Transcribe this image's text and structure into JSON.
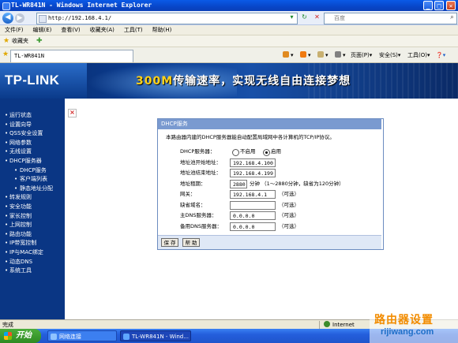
{
  "window": {
    "title": "TL-WR841N - Windows Internet Explorer",
    "min": "_",
    "max": "□",
    "close": "✕"
  },
  "address": {
    "url": "http://192.168.4.1/",
    "go": "▾",
    "refresh": "↻",
    "stop": "✕",
    "search_placeholder": "百度",
    "search_icon": "search-icon"
  },
  "menu": {
    "items": [
      "文件(F)",
      "编辑(E)",
      "查看(V)",
      "收藏夹(A)",
      "工具(T)",
      "帮助(H)"
    ]
  },
  "favorites": {
    "label": "收藏夹"
  },
  "tabs": {
    "current": "TL-WR841N",
    "toolbar": {
      "page": "页面(P)",
      "safety": "安全(S)",
      "tools": "工具(O)",
      "help": "❓"
    }
  },
  "banner": {
    "logo": "TP-LINK",
    "slogan_hi": "300M",
    "slogan": "传输速率，实现无线自由连接梦想"
  },
  "nav": {
    "items": [
      {
        "label": "运行状态",
        "sub": false
      },
      {
        "label": "设置向导",
        "sub": false
      },
      {
        "label": "QSS安全设置",
        "sub": false
      },
      {
        "label": "网络参数",
        "sub": false
      },
      {
        "label": "无线设置",
        "sub": false
      },
      {
        "label": "DHCP服务器",
        "sub": false
      },
      {
        "label": "DHCP服务",
        "sub": true
      },
      {
        "label": "客户端列表",
        "sub": true
      },
      {
        "label": "静态地址分配",
        "sub": true
      },
      {
        "label": "转发规则",
        "sub": false
      },
      {
        "label": "安全功能",
        "sub": false
      },
      {
        "label": "家长控制",
        "sub": false
      },
      {
        "label": "上网控制",
        "sub": false
      },
      {
        "label": "路由功能",
        "sub": false
      },
      {
        "label": "IP带宽控制",
        "sub": false
      },
      {
        "label": "IP与MAC绑定",
        "sub": false
      },
      {
        "label": "动态DNS",
        "sub": false
      },
      {
        "label": "系统工具",
        "sub": false
      }
    ]
  },
  "panel": {
    "title": "DHCP服务",
    "description": "本路由器内建的DHCP服务器能自动配置局域网中各计算机的TCP/IP协议。",
    "dhcp_server_label": "DHCP服务器：",
    "radio_off": "不启用",
    "radio_on": "启用",
    "dhcp_enabled": true,
    "start_label": "地址池开始地址：",
    "start_value": "192.168.4.100",
    "end_label": "地址池结束地址：",
    "end_value": "192.168.4.199",
    "lease_label": "地址租期：",
    "lease_value": "2880",
    "lease_hint": "分钟 （1～2880分钟，缺省为120分钟）",
    "gateway_label": "网关：",
    "gateway_value": "192.168.4.1",
    "domain_label": "缺省域名：",
    "domain_value": "",
    "dns1_label": "主DNS服务器：",
    "dns1_value": "0.0.0.0",
    "dns2_label": "备用DNS服务器：",
    "dns2_value": "0.0.0.0",
    "optional": "（可选）",
    "save": "保 存",
    "help": "帮 助"
  },
  "status": {
    "text": "完成",
    "zone": "Internet"
  },
  "taskbar": {
    "start": "开始",
    "task1": "网络连接",
    "task2": "TL-WR841N - Wind..."
  },
  "watermark": {
    "line1": "路由器设置",
    "line2": "rijiwang.com"
  }
}
